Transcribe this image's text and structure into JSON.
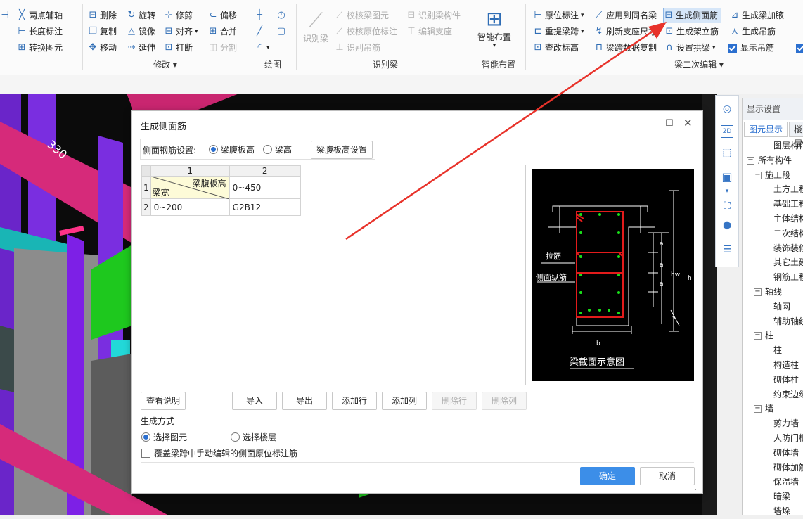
{
  "ribbon": {
    "col0": [
      "两点辅轴",
      "长度标注",
      "转换图元"
    ],
    "modify": {
      "items": [
        "删除",
        "旋转",
        "修剪",
        "偏移",
        "复制",
        "镜像",
        "对齐",
        "合并",
        "移动",
        "延伸",
        "打断",
        "分割"
      ],
      "label": "修改"
    },
    "draw_label": "绘图",
    "identify": {
      "big": "识别梁",
      "items": [
        "校核梁图元",
        "识别梁构件",
        "校核原位标注",
        "编辑支座",
        "识别吊筋"
      ],
      "label": "识别梁"
    },
    "smart": {
      "big": "智能布置",
      "label": "智能布置"
    },
    "secondary": {
      "items": [
        "原位标注",
        "应用到同名梁",
        "生成侧面筋",
        "生成梁加腋",
        "重提梁跨",
        "刷新支座尺寸",
        "生成架立筋",
        "生成吊筋",
        "查改标高",
        "梁跨数据复制",
        "设置拱梁",
        "显示吊筋"
      ],
      "label": "梁二次编辑"
    }
  },
  "viewport": {
    "label_330": "330"
  },
  "display_panel": {
    "title": "显示设置",
    "tabs": [
      "图元显示",
      "楼层"
    ],
    "tree": [
      "图层构件",
      "所有构件",
      "施工段",
      "土方工程",
      "基础工程",
      "主体结构",
      "二次结构",
      "装饰装修",
      "其它土建",
      "钢筋工程",
      "轴线",
      "轴网",
      "辅助轴线",
      "柱",
      "柱",
      "构造柱",
      "砌体柱",
      "约束边缘",
      "墙",
      "剪力墙",
      "人防门框",
      "砌体墙",
      "砌体加筋",
      "保温墙",
      "暗梁",
      "墙垛"
    ]
  },
  "dialog": {
    "title": "生成侧面筋",
    "setting_label": "侧面钢筋设置:",
    "radio_web_height": "梁腹板高",
    "radio_beam_height": "梁高",
    "web_height_settings_button": "梁腹板高设置",
    "table": {
      "col_headers": [
        "1",
        "2"
      ],
      "row_headers": [
        "1",
        "2"
      ],
      "corner_top": "梁腹板高",
      "corner_bottom": "梁宽",
      "r1c2": "0~450",
      "r2c1": "0~200",
      "r2c2": "G2B12"
    },
    "diagram": {
      "tie_label": "拉筋",
      "side_long_label": "侧面纵筋",
      "caption": "梁截面示意图",
      "dim_a": "a",
      "dim_hw": "hw",
      "dim_h": "h",
      "dim_s": "s",
      "dim_b": "b"
    },
    "buttons": {
      "view_help": "查看说明",
      "import": "导入",
      "export": "导出",
      "add_row": "添加行",
      "add_col": "添加列",
      "del_row": "删除行",
      "del_col": "删除列",
      "ok": "确定",
      "cancel": "取消"
    },
    "gen_method_label": "生成方式",
    "radio_select_element": "选择图元",
    "radio_select_floor": "选择楼层",
    "override_checkbox_label": "覆盖梁跨中手动编辑的侧面原位标注筋"
  },
  "colors": {
    "accent": "#3c8ee8",
    "annotation_arrow": "#e8322a"
  }
}
